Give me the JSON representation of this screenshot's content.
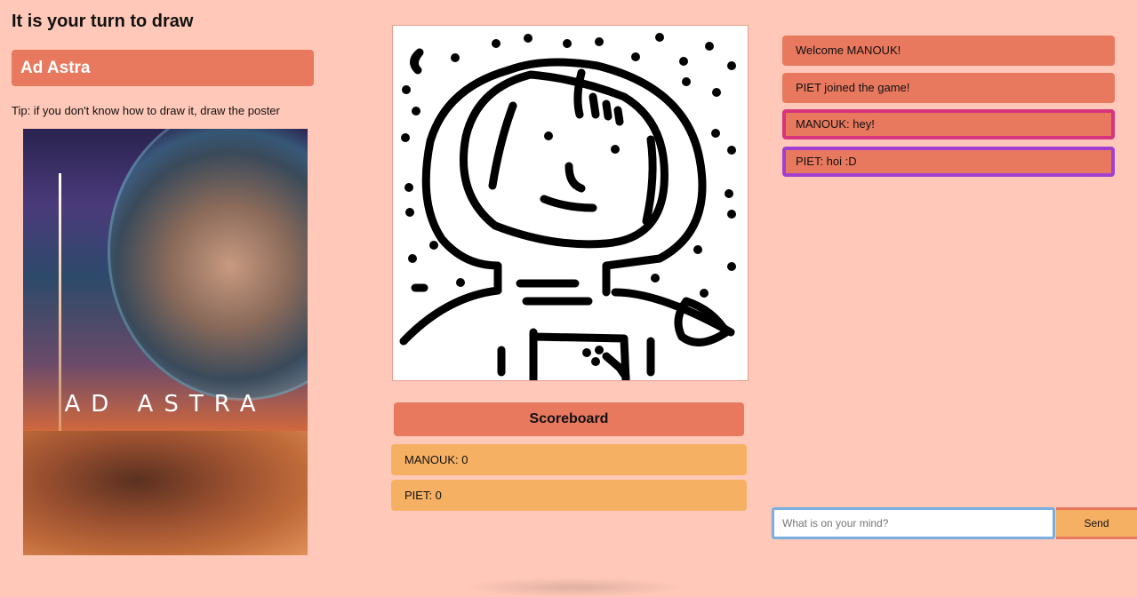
{
  "game": {
    "heading": "It is your turn to draw",
    "movie_title": "Ad Astra",
    "tip": "Tip: if you don't know how to draw it, draw the poster",
    "poster_title": "AD ASTRA"
  },
  "scoreboard": {
    "title": "Scoreboard",
    "rows": [
      {
        "label": "MANOUK: 0"
      },
      {
        "label": "PIET: 0"
      }
    ]
  },
  "chat": {
    "messages": [
      {
        "text": "Welcome MANOUK!",
        "type": "system"
      },
      {
        "text": "PIET joined the game!",
        "type": "system"
      },
      {
        "text": "MANOUK: hey!",
        "type": "user",
        "color": "#d6347e"
      },
      {
        "text": "PIET: hoi :D",
        "type": "user",
        "color": "#a23fd0"
      }
    ],
    "input_placeholder": "What is on your mind?",
    "input_value": "",
    "send_label": "Send"
  },
  "colors": {
    "background": "#ffc8b8",
    "accent": "#e8785e",
    "score_row": "#f6b064",
    "input_focus": "#7aaee0"
  }
}
